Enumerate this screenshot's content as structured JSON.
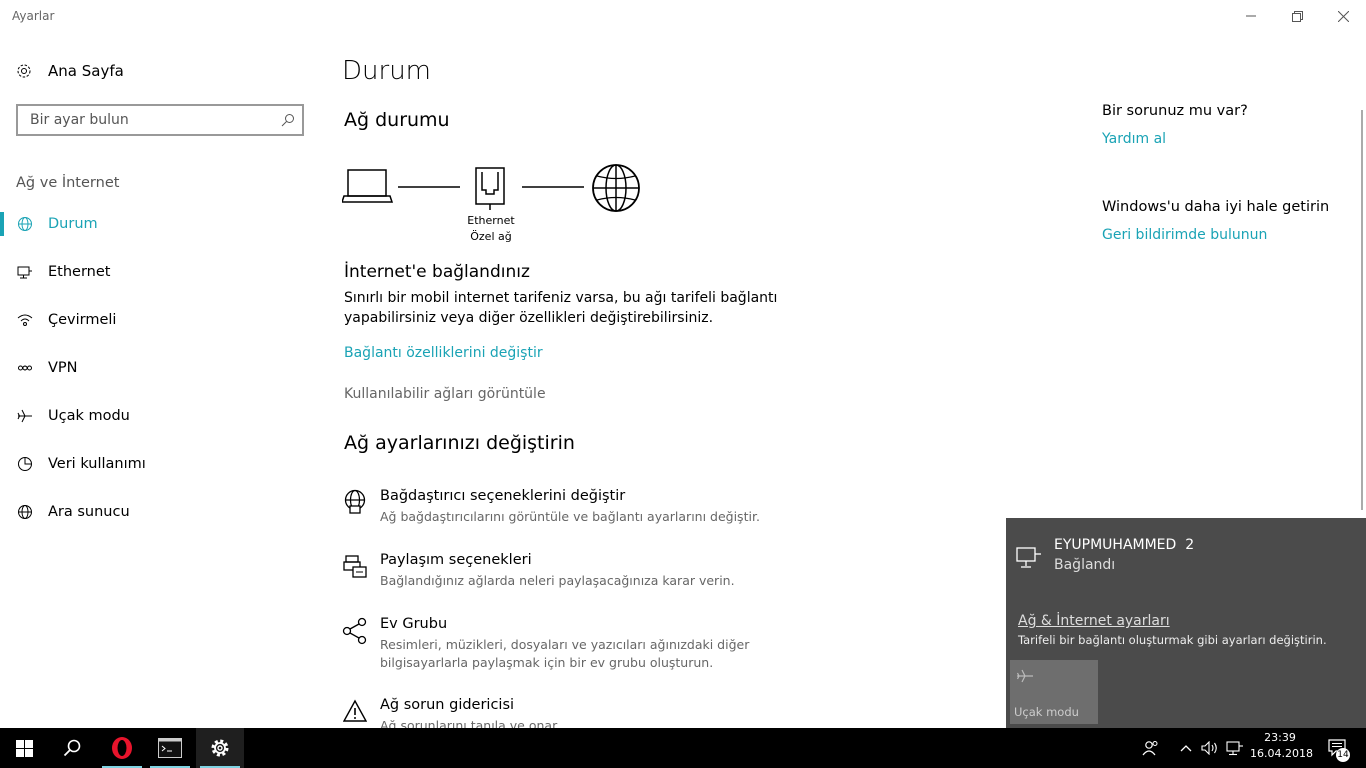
{
  "window": {
    "title": "Ayarlar",
    "controls": [
      "minimize",
      "restore",
      "close"
    ]
  },
  "sidebar": {
    "home_label": "Ana Sayfa",
    "search_placeholder": "Bir ayar bulun",
    "section_title": "Ağ ve İnternet",
    "items": [
      {
        "label": "Durum",
        "icon": "globe-icon",
        "active": true
      },
      {
        "label": "Ethernet",
        "icon": "ethernet-icon",
        "active": false
      },
      {
        "label": "Çevirmeli",
        "icon": "dialup-icon",
        "active": false
      },
      {
        "label": "VPN",
        "icon": "vpn-icon",
        "active": false
      },
      {
        "label": "Uçak modu",
        "icon": "airplane-icon",
        "active": false
      },
      {
        "label": "Veri kullanımı",
        "icon": "data-usage-icon",
        "active": false
      },
      {
        "label": "Ara sunucu",
        "icon": "proxy-icon",
        "active": false
      }
    ]
  },
  "main": {
    "page_title": "Durum",
    "network_status_title": "Ağ durumu",
    "diagram": {
      "adapter_label": "Ethernet",
      "network_label": "Özel ağ"
    },
    "connected_title": "İnternet'e bağlandınız",
    "connected_desc_1": "Sınırlı bir mobil internet tarifeniz varsa, bu ağı tarifeli bağlantı",
    "connected_desc_2": "yapabilirsiniz veya diğer özellikleri değiştirebilirsiniz.",
    "change_props_link": "Bağlantı özelliklerini değiştir",
    "view_networks": "Kullanılabilir ağları görüntüle",
    "change_settings_title": "Ağ ayarlarınızı değiştirin",
    "options": [
      {
        "title": "Bağdaştırıcı seçeneklerini değiştir",
        "desc": "Ağ bağdaştırıcılarını görüntüle ve bağlantı ayarlarını değiştir.",
        "icon": "adapter-icon"
      },
      {
        "title": "Paylaşım seçenekleri",
        "desc": "Bağlandığınız ağlarda neleri paylaşacağınıza karar verin.",
        "icon": "sharing-icon"
      },
      {
        "title": "Ev Grubu",
        "desc": "Resimleri, müzikleri, dosyaları ve yazıcıları ağınızdaki diğer",
        "desc2": "bilgisayarlarla paylaşmak için bir ev grubu oluşturun.",
        "icon": "homegroup-icon"
      },
      {
        "title": "Ağ sorun gidericisi",
        "desc": "Ağ sorunlarını tanıla ve onar.",
        "icon": "warning-icon"
      }
    ]
  },
  "right_panel": {
    "question": "Bir sorunuz mu var?",
    "help_link": "Yardım al",
    "improve": "Windows'u daha iyi hale getirin",
    "feedback_link": "Geri bildirimde bulunun"
  },
  "flyout": {
    "network_name": "EYUPMUHAMMED  2",
    "network_status": "Bağlandı",
    "settings_link": "Ağ & İnternet ayarları",
    "settings_desc": "Tarifeli bir bağlantı oluşturmak gibi ayarları değiştirin.",
    "airplane_tile": "Uçak modu"
  },
  "taskbar": {
    "time": "23:39",
    "date": "16.04.2018",
    "notification_count": "14"
  },
  "colors": {
    "accent": "#1aa3b5",
    "flyout_bg": "#4b4b4b",
    "taskbar_bg": "#000000"
  }
}
